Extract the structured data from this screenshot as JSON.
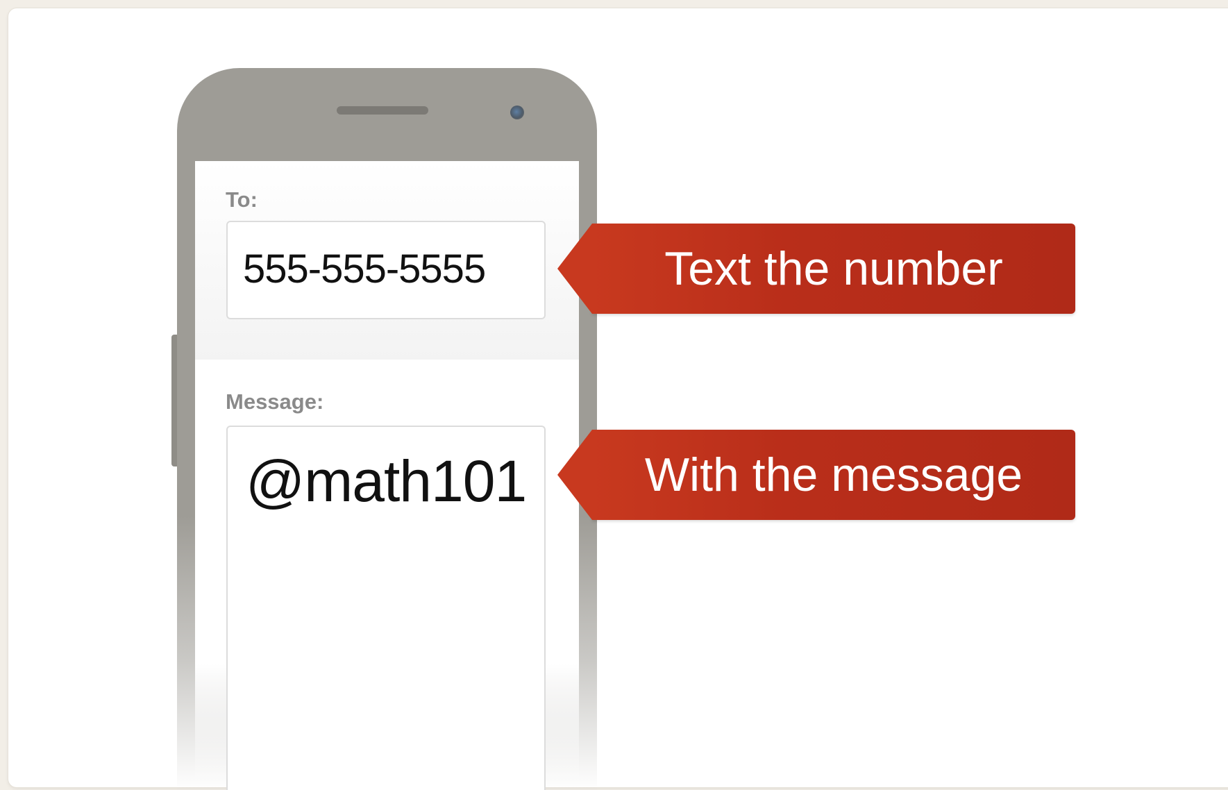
{
  "to_field": {
    "label": "To:",
    "value": "555-555-5555"
  },
  "message_field": {
    "label": "Message:",
    "value": "@math101"
  },
  "callouts": [
    {
      "text": "Text the number"
    },
    {
      "text": "With the message"
    }
  ],
  "colors": {
    "callout_red": "#b92e1a",
    "phone_gray": "#9e9c96",
    "background": "#f2eee7"
  },
  "icons": {
    "speaker": "speaker-grille-icon",
    "camera": "front-camera-icon"
  }
}
